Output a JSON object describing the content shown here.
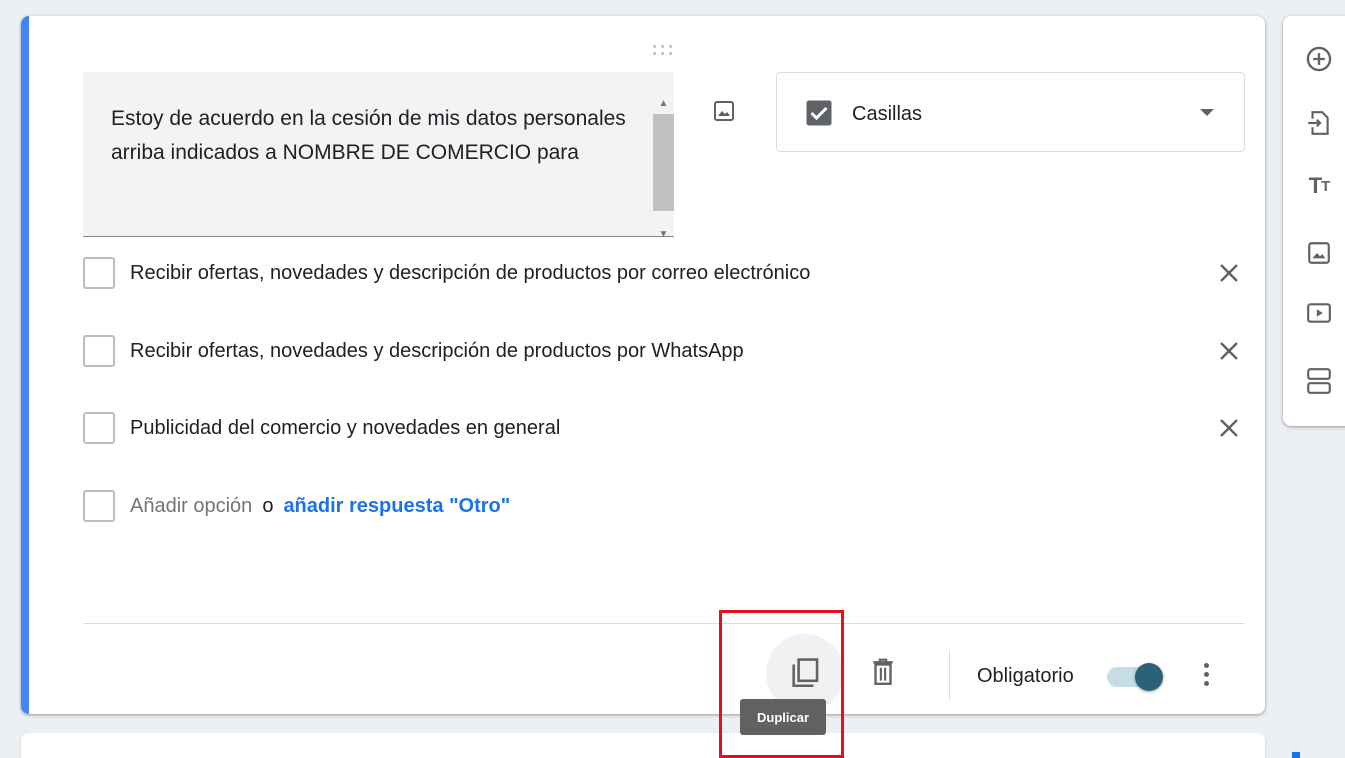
{
  "question": {
    "title": "Estoy de acuerdo en la cesión de mis datos personales arriba indicados a NOMBRE DE COMERCIO para",
    "type_label": "Casillas"
  },
  "options": [
    {
      "label": "Recibir ofertas, novedades y descripción de productos por correo electrónico"
    },
    {
      "label": "Recibir ofertas, novedades y descripción de productos por WhatsApp"
    },
    {
      "label": "Publicidad del comercio y novedades en general"
    }
  ],
  "add_option": {
    "label": "Añadir opción",
    "or_text": "o",
    "other_label": "añadir respuesta \"Otro\""
  },
  "footer": {
    "duplicate_tooltip": "Duplicar",
    "required_label": "Obligatorio",
    "required_on": true
  },
  "side_toolbar": {
    "icons": [
      "add-question-icon",
      "import-questions-icon",
      "add-title-icon",
      "add-image-icon",
      "add-video-icon",
      "add-section-icon"
    ]
  },
  "colors": {
    "accent": "#4285f4",
    "link": "#1a73e8",
    "highlight": "#e5101f",
    "toggle": "#2b6179"
  }
}
